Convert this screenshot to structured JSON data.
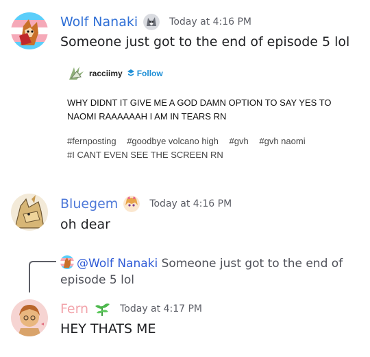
{
  "messages": [
    {
      "username": "Wolf Nanaki",
      "username_color": "#2f6fd6",
      "timestamp": "Today at 4:16 PM",
      "text": "Someone just got to the end of episode 5 lol",
      "embed": {
        "user": "racciimy",
        "follow": "Follow",
        "post_text": "WHY DIDNT IT GIVE ME A GOD DAMN OPTION TO SAY YES TO NAOMI RAAAAAAH I AM IN TEARS RN",
        "tags": [
          "#fernposting",
          "#goodbye volcano high",
          "#gvh",
          "#gvh naomi",
          "#I CANT EVEN SEE THE SCREEN RN"
        ]
      }
    },
    {
      "username": "Bluegem",
      "username_color": "#4d78d8",
      "timestamp": "Today at 4:16 PM",
      "text": "oh dear"
    },
    {
      "reply_to": {
        "mention": "@Wolf Nanaki",
        "snippet": "Someone just got to the end of episode 5 lol"
      },
      "username": "Fern",
      "username_color": "#f2a4ab",
      "timestamp": "Today at 4:17 PM",
      "text": "HEY THATS ME"
    }
  ],
  "icons": {
    "wolf_badge": "wolf-head-icon",
    "bluegem_badge": "anime-character-icon",
    "fern_badge": "leaf-icon",
    "follow": "tumblr-follow-icon"
  }
}
